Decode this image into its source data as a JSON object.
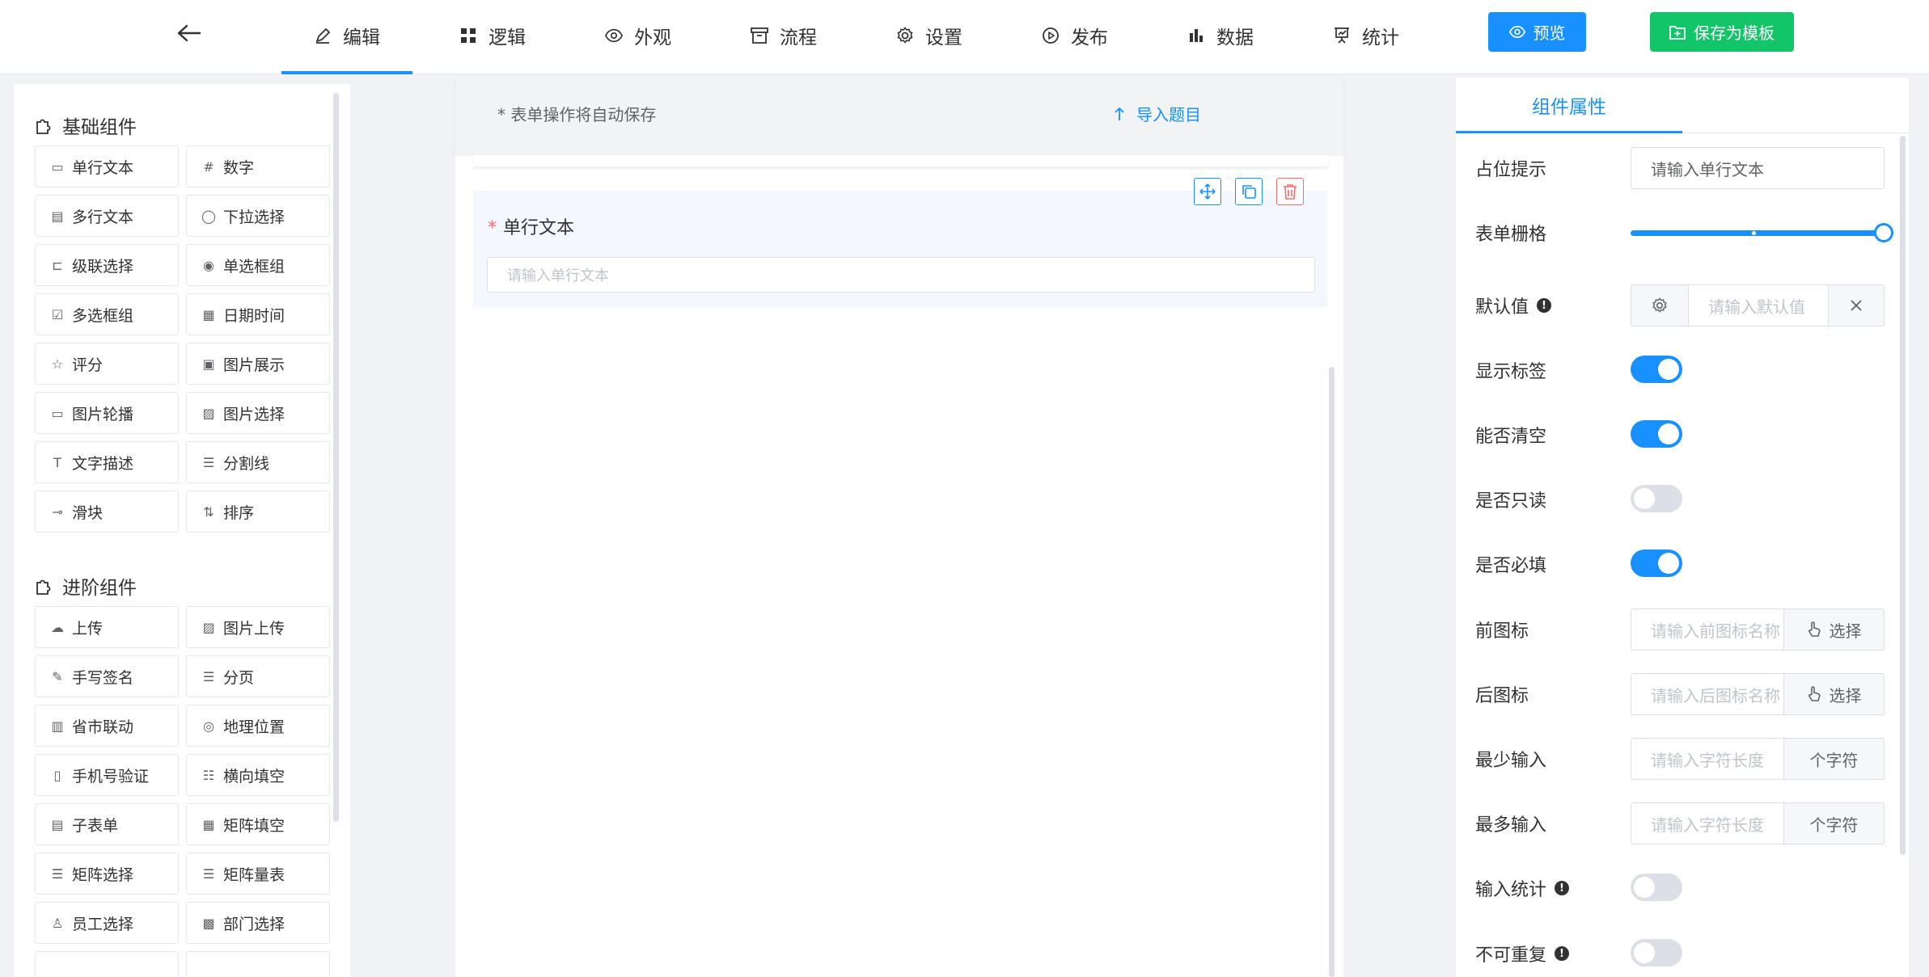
{
  "nav": {
    "items": [
      {
        "label": "编辑",
        "icon": "edit-icon",
        "active": true
      },
      {
        "label": "逻辑",
        "icon": "grid-icon",
        "active": false
      },
      {
        "label": "外观",
        "icon": "eye-icon",
        "active": false
      },
      {
        "label": "流程",
        "icon": "archive-icon",
        "active": false
      },
      {
        "label": "设置",
        "icon": "gear-icon",
        "active": false
      },
      {
        "label": "发布",
        "icon": "play-circle-icon",
        "active": false
      },
      {
        "label": "数据",
        "icon": "bar-chart-icon",
        "active": false
      },
      {
        "label": "统计",
        "icon": "presentation-icon",
        "active": false
      }
    ],
    "preview_label": "预览",
    "save_template_label": "保存为模板"
  },
  "palette": {
    "basic_title": "基础组件",
    "basic_items": [
      {
        "label": "单行文本",
        "icon": "input-icon"
      },
      {
        "label": "数字",
        "icon": "number-icon"
      },
      {
        "label": "多行文本",
        "icon": "textarea-icon"
      },
      {
        "label": "下拉选择",
        "icon": "dropdown-icon"
      },
      {
        "label": "级联选择",
        "icon": "cascader-icon"
      },
      {
        "label": "单选框组",
        "icon": "radio-icon"
      },
      {
        "label": "多选框组",
        "icon": "checkbox-icon"
      },
      {
        "label": "日期时间",
        "icon": "calendar-icon"
      },
      {
        "label": "评分",
        "icon": "star-icon"
      },
      {
        "label": "图片展示",
        "icon": "image-icon"
      },
      {
        "label": "图片轮播",
        "icon": "carousel-icon"
      },
      {
        "label": "图片选择",
        "icon": "image-select-icon"
      },
      {
        "label": "文字描述",
        "icon": "text-icon"
      },
      {
        "label": "分割线",
        "icon": "divider-icon"
      },
      {
        "label": "滑块",
        "icon": "slider-icon"
      },
      {
        "label": "排序",
        "icon": "sort-icon"
      }
    ],
    "advanced_title": "进阶组件",
    "advanced_items": [
      {
        "label": "上传",
        "icon": "upload-icon"
      },
      {
        "label": "图片上传",
        "icon": "image-upload-icon"
      },
      {
        "label": "手写签名",
        "icon": "pen-icon"
      },
      {
        "label": "分页",
        "icon": "page-break-icon"
      },
      {
        "label": "省市联动",
        "icon": "city-icon"
      },
      {
        "label": "地理位置",
        "icon": "location-icon"
      },
      {
        "label": "手机号验证",
        "icon": "phone-icon"
      },
      {
        "label": "横向填空",
        "icon": "fill-blank-icon"
      },
      {
        "label": "子表单",
        "icon": "subform-icon"
      },
      {
        "label": "矩阵填空",
        "icon": "matrix-fill-icon"
      },
      {
        "label": "矩阵选择",
        "icon": "matrix-select-icon"
      },
      {
        "label": "矩阵量表",
        "icon": "matrix-scale-icon"
      },
      {
        "label": "员工选择",
        "icon": "user-icon"
      },
      {
        "label": "部门选择",
        "icon": "department-icon"
      }
    ]
  },
  "canvas": {
    "save_hint": "* 表单操作将自动保存",
    "import_label": "导入题目",
    "field": {
      "required_mark": "*",
      "label": "单行文本",
      "placeholder": "请输入单行文本"
    }
  },
  "props": {
    "tab_label": "组件属性",
    "placeholder_label": "占位提示",
    "placeholder_value": "请输入单行文本",
    "grid_label": "表单栅格",
    "grid_value_fraction": 1.0,
    "default_label": "默认值",
    "default_placeholder": "请输入默认值",
    "show_label_label": "显示标签",
    "show_label_on": true,
    "clearable_label": "能否清空",
    "clearable_on": true,
    "readonly_label": "是否只读",
    "readonly_on": false,
    "required_label": "是否必填",
    "required_on": true,
    "prefix_label": "前图标",
    "prefix_placeholder": "请输入前图标名称",
    "suffix_label": "后图标",
    "suffix_placeholder": "请输入后图标名称",
    "select_label": "选择",
    "min_label": "最少输入",
    "min_placeholder": "请输入字符长度",
    "max_label": "最多输入",
    "max_placeholder": "请输入字符长度",
    "chars_unit": "个字符",
    "count_label": "输入统计",
    "count_on": false,
    "unique_label": "不可重复",
    "unique_on": false
  }
}
